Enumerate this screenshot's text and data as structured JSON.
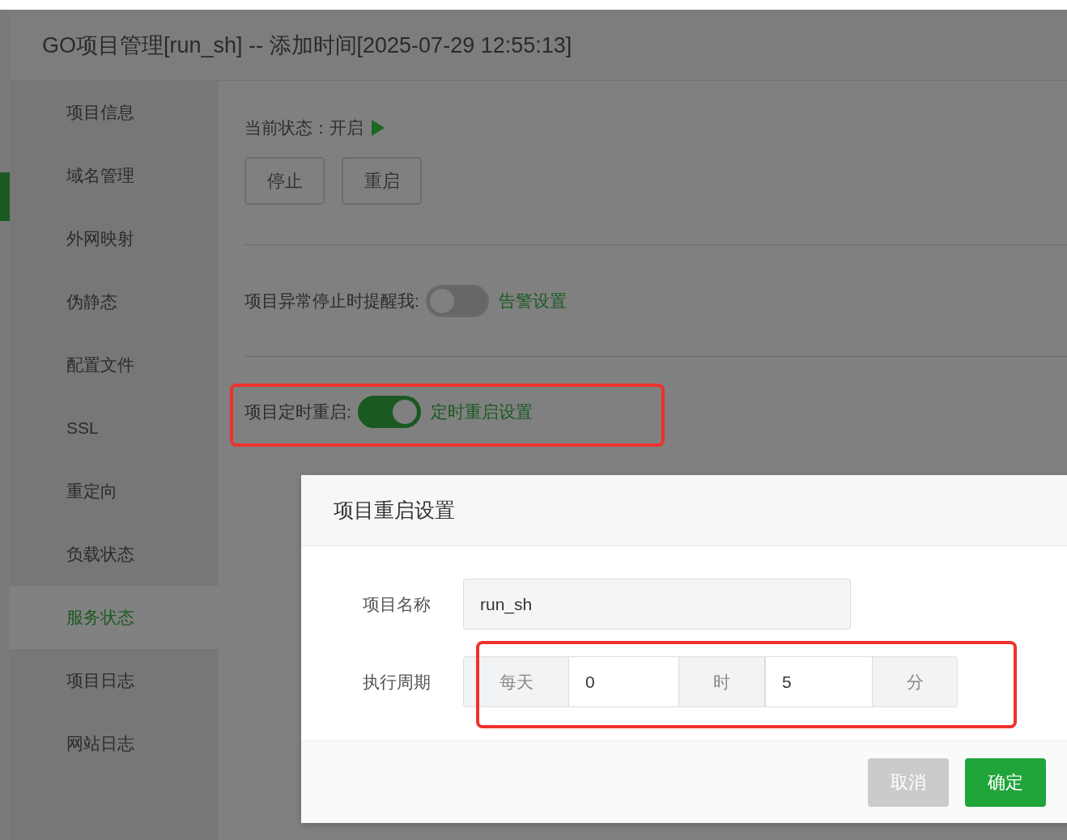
{
  "window": {
    "title": "GO项目管理[run_sh] -- 添加时间[2025-07-29 12:55:13]"
  },
  "sidebar": {
    "items": [
      {
        "label": "项目信息",
        "selected": false
      },
      {
        "label": "域名管理",
        "selected": false
      },
      {
        "label": "外网映射",
        "selected": false
      },
      {
        "label": "伪静态",
        "selected": false
      },
      {
        "label": "配置文件",
        "selected": false
      },
      {
        "label": "SSL",
        "selected": false
      },
      {
        "label": "重定向",
        "selected": false
      },
      {
        "label": "负载状态",
        "selected": false
      },
      {
        "label": "服务状态",
        "selected": true
      },
      {
        "label": "项目日志",
        "selected": false
      },
      {
        "label": "网站日志",
        "selected": false
      }
    ]
  },
  "status": {
    "label": "当前状态：",
    "value": "开启",
    "running": true
  },
  "actions": [
    "停止",
    "重启"
  ],
  "alert": {
    "label": "项目异常停止时提醒我:",
    "on": false,
    "link": "告警设置"
  },
  "scheduled_restart": {
    "label": "项目定时重启:",
    "on": true,
    "link": "定时重启设置"
  },
  "modal": {
    "title": "项目重启设置",
    "name_label": "项目名称",
    "name_value": "run_sh",
    "period_label": "执行周期",
    "period_type": "每天",
    "hour_value": "0",
    "hour_unit": "时",
    "minute_value": "5",
    "minute_unit": "分",
    "buttons": {
      "cancel": "取消",
      "confirm": "确定"
    }
  }
}
